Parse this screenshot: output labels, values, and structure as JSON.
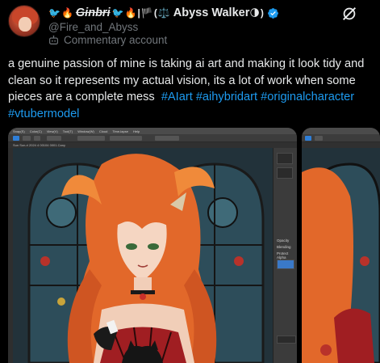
{
  "post": {
    "display_name": "Abyss Walker",
    "name_prefix_emoji": [
      "🐦",
      "🔥"
    ],
    "name_strike": "Ginbri",
    "name_mid_emoji": [
      "🐦",
      "🔥",
      "|",
      "🏴",
      "("
    ],
    "name_after_emoji": [
      "⚖️"
    ],
    "name_suffix_emoji": [
      "🌗",
      ")"
    ],
    "handle": "@Fire_and_Abyss",
    "account_label": "Commentary account",
    "text_plain": "a genuine passion of mine is taking ai art and making it look tidy and clean so it represents my actual vision, its a lot of work when some pieces are a complete mess",
    "hashtags": [
      "#AIart",
      "#aihybridart",
      "#originalcharacter",
      "#vtubermodel"
    ]
  },
  "app_window": {
    "menu_items": [
      "Snap(S)",
      "Color(C)",
      "View(V)",
      "Tool(T)",
      "Window(W)",
      "Cloud",
      "Time-lapse",
      "Help"
    ],
    "tab_title": "Sun Sun-ri 2024 4 00104 0001.Cany",
    "panel_labels": [
      "Opacity",
      "Blending",
      "Protect Alpha"
    ]
  },
  "colors": {
    "background": "#000000",
    "text_primary": "#e7e9ea",
    "text_secondary": "#71767b",
    "link": "#1d9bf0",
    "verified": "#1d9bf0"
  },
  "icons": {
    "verified": "verified-badge-icon",
    "account_type": "bot-icon",
    "more": "grok-icon"
  }
}
